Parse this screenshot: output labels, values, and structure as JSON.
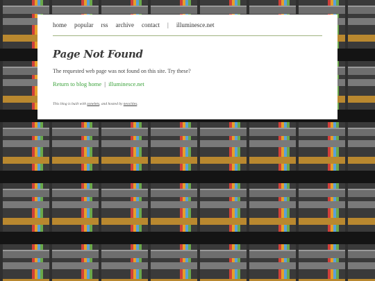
{
  "nav": {
    "home": "home",
    "popular": "popular",
    "rss": "rss",
    "archive": "archive",
    "contact": "contact",
    "separator": "|",
    "site": "illuminesce.net"
  },
  "page": {
    "title": "Page Not Found",
    "message": "The requested web page was not found on this site. Try these?"
  },
  "links": {
    "blog_home": "Return to blog home",
    "separator": "|",
    "site": "illuminesce.net"
  },
  "footer": {
    "prefix": "This blog is built with",
    "builder": "zonelets",
    "middle": ", and hosted by",
    "host": "neocities",
    "suffix": "."
  },
  "colors": {
    "link_green": "#3aa23a",
    "rule_green": "#9fb27e"
  }
}
